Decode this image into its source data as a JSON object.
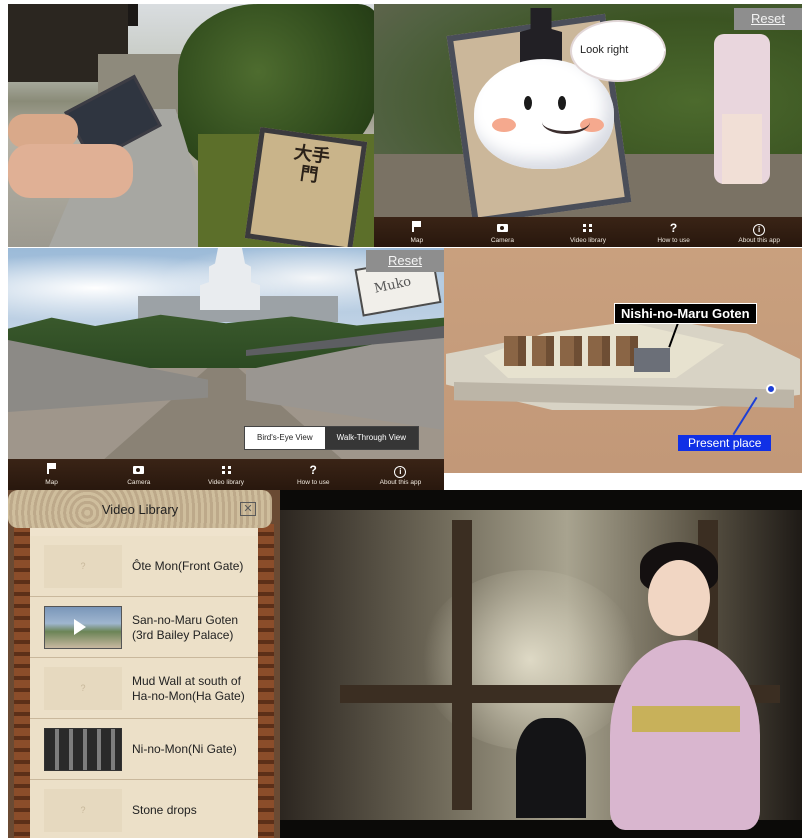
{
  "panel1": {
    "sign_text": "大手門"
  },
  "panel2": {
    "reset_label": "Reset",
    "bubble_text": "Look right",
    "bubble_dots": "◆◆◆",
    "toolbar": [
      {
        "label": "Map",
        "icon": "flag-icon"
      },
      {
        "label": "Camera",
        "icon": "camera-icon"
      },
      {
        "label": "Video library",
        "icon": "grid-icon"
      },
      {
        "label": "How to use",
        "icon": "question-icon"
      },
      {
        "label": "About this app",
        "icon": "info-icon"
      }
    ]
  },
  "panel3": {
    "reset_label": "Reset",
    "speech_text": "Muko",
    "view_options": [
      "Bird's-Eye View",
      "Walk-Through View"
    ],
    "selected_view": "Walk-Through View",
    "toolbar": [
      {
        "label": "Map",
        "icon": "flag-icon"
      },
      {
        "label": "Camera",
        "icon": "camera-icon"
      },
      {
        "label": "Video library",
        "icon": "grid-icon"
      },
      {
        "label": "How to use",
        "icon": "question-icon"
      },
      {
        "label": "About this app",
        "icon": "info-icon"
      }
    ]
  },
  "panel4": {
    "building_label": "Nishi-no-Maru Goten",
    "location_label": "Present place"
  },
  "video_library": {
    "title": "Video Library",
    "close_label": "✕",
    "items": [
      {
        "title": "Ôte Mon(Front Gate)",
        "thumb": "?"
      },
      {
        "title": "San-no-Maru Goten (3rd Bailey Palace)",
        "thumb": ""
      },
      {
        "title": "Mud Wall at south of Ha-no-Mon(Ha Gate)",
        "thumb": "?"
      },
      {
        "title": "Ni-no-Mon(Ni Gate)",
        "thumb": ""
      },
      {
        "title": "Stone drops",
        "thumb": "?"
      }
    ]
  },
  "colors": {
    "toolbar_bg": "#2f1c10",
    "present_place_blue": "#1030e6",
    "label_black": "#000000"
  }
}
